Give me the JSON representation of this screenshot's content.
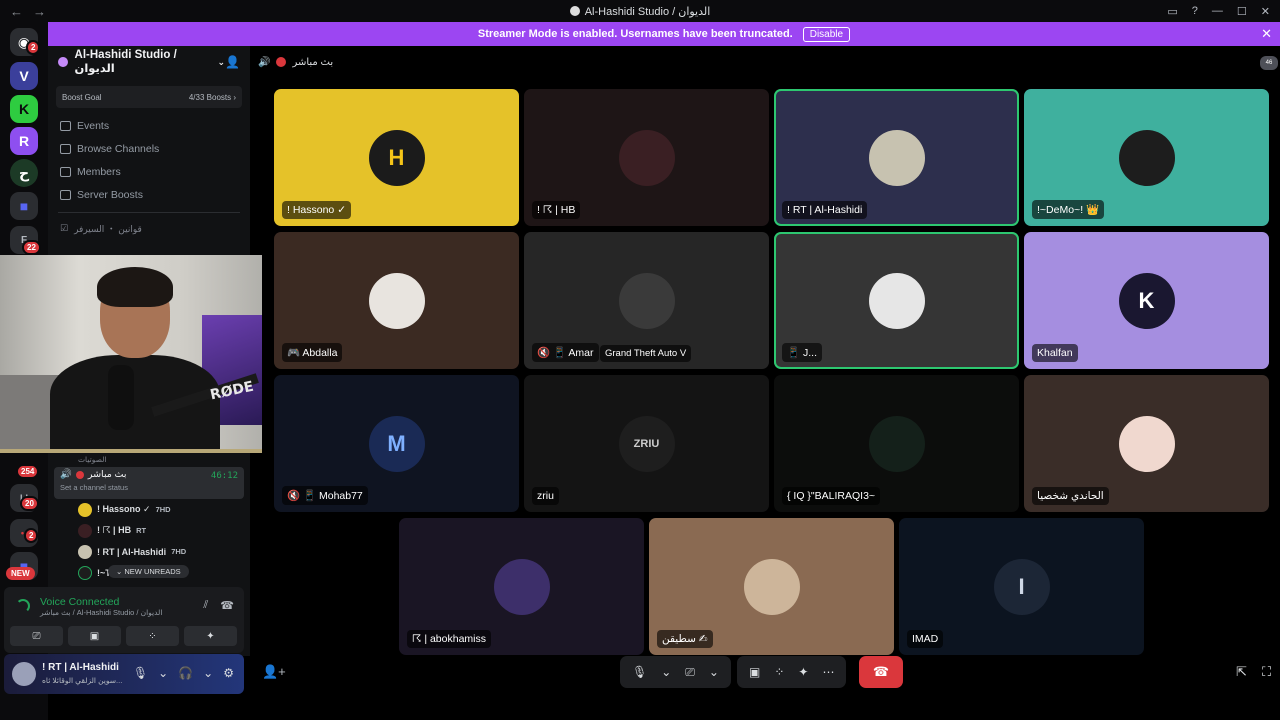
{
  "window": {
    "title": "Al-Hashidi Studio / الديوان",
    "back": "←",
    "forward": "→",
    "controls": [
      "▭",
      "?",
      "—",
      "☐",
      "✕"
    ]
  },
  "banner": {
    "text": "Streamer Mode is enabled. Usernames have been truncated.",
    "button": "Disable",
    "close": "✕"
  },
  "rail": {
    "badges": [
      "2",
      "22",
      "254",
      "20",
      "2"
    ],
    "new_label": "NEW"
  },
  "sidebar": {
    "server_name": "Al-Hashidi Studio / الديوان",
    "boost_label": "Boost Goal",
    "boost_count": "4/33 Boosts ›",
    "menu": [
      "Events",
      "Browse Channels",
      "Members",
      "Server Boosts"
    ],
    "channel_row": "قوانين ・ السيرفر"
  },
  "voice_list": {
    "category": "الصوتيات",
    "channel_name": "بث مباشر",
    "channel_status": "Set a channel status",
    "timer": "46:12",
    "users": [
      {
        "name": "! Hassono ✓",
        "tag": "7HD"
      },
      {
        "name": "! ☈ | HB",
        "tag": "RT"
      },
      {
        "name": "! RT | Al-Hashidi",
        "tag": "7HD"
      },
      {
        "name": "!~T",
        "tag": ""
      }
    ],
    "new_unreads": "NEW UNREADS"
  },
  "voice_panel": {
    "title": "Voice Connected",
    "subtitle": "بث مباشر / Al-Hashidi Studio / الديوان",
    "actions": [
      "⎚",
      "▣",
      "⁘",
      "✦"
    ]
  },
  "user_panel": {
    "name": "! RT | Al-Hashidi",
    "status": "سوين الزلقي الوقائلا ثاه...",
    "controls": [
      "🎙",
      "⌄",
      "🎧",
      "⌄",
      "⚙"
    ]
  },
  "call_header": {
    "channel": "بث مباشر"
  },
  "chat_count": "46",
  "tiles": [
    {
      "label": "! Hassono ✓",
      "bg": "#e5c229",
      "avatar_bg": "#1b1b1b",
      "avatar_text": "H",
      "avatar_color": "#f5c518",
      "selected": false
    },
    {
      "label": "! ☈ | HB",
      "bg": "#1e1516",
      "avatar_bg": "#3a1f23",
      "avatar_text": "",
      "avatar_color": "#fff",
      "selected": false
    },
    {
      "label": "! RT | Al-Hashidi",
      "bg": "#2d2f4d",
      "avatar_bg": "#c7c2b0",
      "avatar_text": "",
      "avatar_color": "#fff",
      "selected": true
    },
    {
      "label": "!~DeMo~! 👑",
      "bg": "#3fb09e",
      "avatar_bg": "#1d1d1d",
      "avatar_text": "",
      "avatar_color": "#fff",
      "selected": false
    },
    {
      "label": "🎮 Abdalla",
      "bg": "#3b2a22",
      "avatar_bg": "#e8e4df",
      "avatar_text": "",
      "avatar_color": "#fff",
      "selected": false
    },
    {
      "label": "🔇 📱 Amar",
      "bg": "#262626",
      "avatar_bg": "#3a3a3a",
      "avatar_text": "",
      "avatar_color": "#fff",
      "selected": false,
      "activity": "Grand Theft Auto V"
    },
    {
      "label": "📱 J...",
      "bg": "#353535",
      "avatar_bg": "#e6e6e6",
      "avatar_text": "",
      "avatar_color": "#fff",
      "selected": true
    },
    {
      "label": "Khalfan",
      "bg": "#a58ee0",
      "avatar_bg": "#1a1730",
      "avatar_text": "K",
      "avatar_color": "#ffffff",
      "selected": false
    },
    {
      "label": "🔇 📱 Mohab77",
      "bg": "#0f1421",
      "avatar_bg": "#1a2a55",
      "avatar_text": "M",
      "avatar_color": "#7fb0ff",
      "selected": false
    },
    {
      "label": "zriu",
      "bg": "#141414",
      "avatar_bg": "#1e1e1e",
      "avatar_text": "ZRIU",
      "avatar_color": "#cccccc",
      "selected": false
    },
    {
      "label": "{ IQ }\"BALIRAQI3~",
      "bg": "#0c0d0c",
      "avatar_bg": "#14201a",
      "avatar_text": "",
      "avatar_color": "#fff",
      "selected": false
    },
    {
      "label": "الحاندي شخصيا",
      "bg": "#3a2d28",
      "avatar_bg": "#f0d8cf",
      "avatar_text": "",
      "avatar_color": "#fff",
      "selected": false
    },
    {
      "label": "☈ | abokhamiss",
      "bg": "#1a1524",
      "avatar_bg": "#3d2f6a",
      "avatar_text": "",
      "avatar_color": "#fff",
      "selected": false
    },
    {
      "label": "سطيقن ✍",
      "bg": "#8a6a52",
      "avatar_bg": "#cdb59a",
      "avatar_text": "",
      "avatar_color": "#fff",
      "selected": false
    },
    {
      "label": "IMAD",
      "bg": "#0c1420",
      "avatar_bg": "#1c2636",
      "avatar_text": "I",
      "avatar_color": "#cfd8e6",
      "selected": false
    }
  ],
  "controls": {
    "mic": "🎙",
    "mic_dd": "⌄",
    "cam": "⎚",
    "cam_dd": "⌄",
    "share": "▣",
    "activities": "⁘",
    "soundboard": "✦",
    "more": "⋯",
    "hangup": "☎"
  }
}
